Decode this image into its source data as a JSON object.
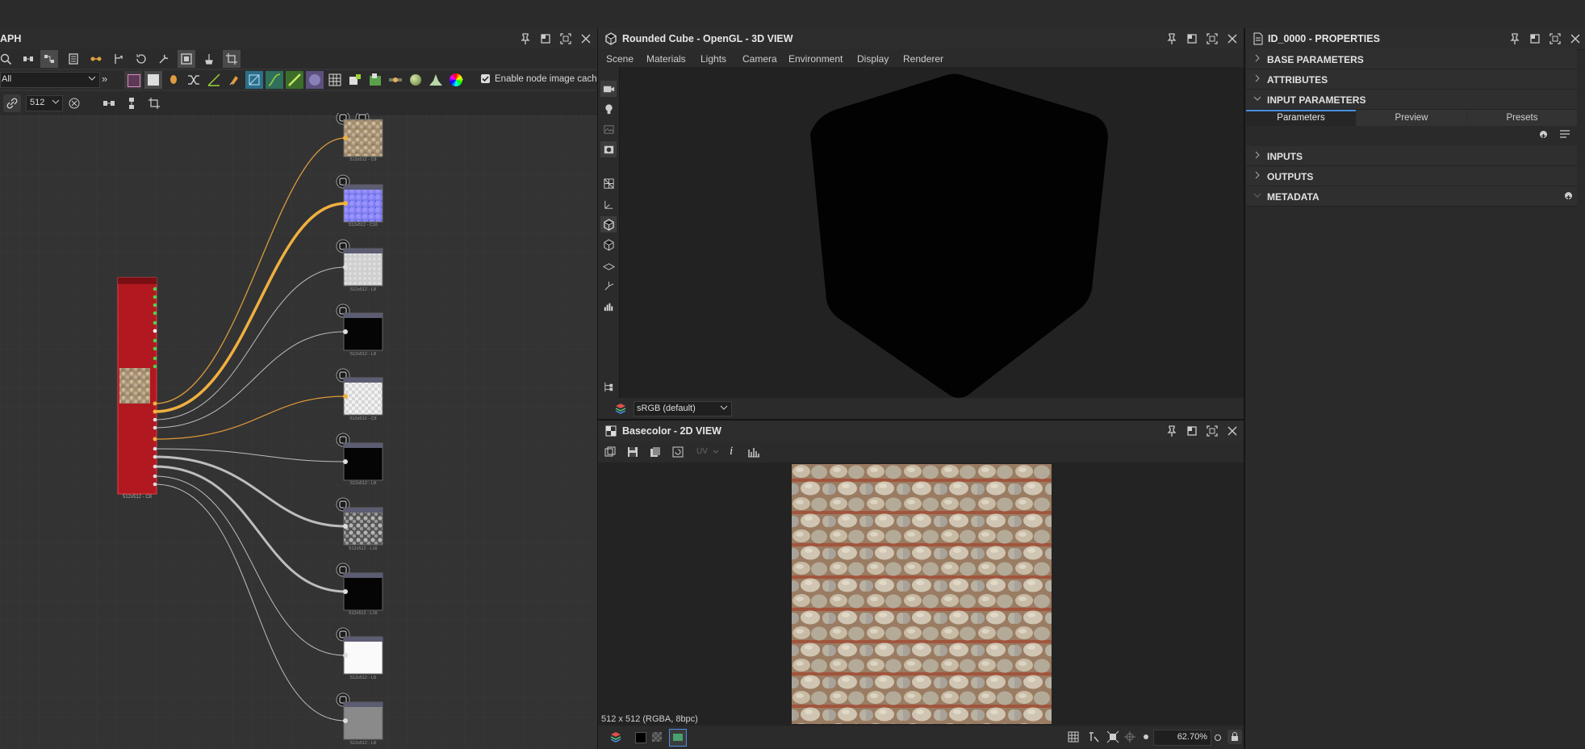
{
  "graph": {
    "title": "APH",
    "filter_value": "All",
    "enable_cache_label": "Enable node image cache",
    "resolution_value": "512",
    "more_label": "»",
    "output_node_label": "512x512 - C8",
    "nodes": [
      {
        "res": "512x512 - C8",
        "fill": "stone"
      },
      {
        "res": "512x512 - C16",
        "fill": "normal"
      },
      {
        "res": "512x512 - L8",
        "fill": "rough"
      },
      {
        "res": "512x512 - L8",
        "fill": "black"
      },
      {
        "res": "512x512 - C8",
        "fill": "checker"
      },
      {
        "res": "512x512 - L8",
        "fill": "black"
      },
      {
        "res": "512x512 - L16",
        "fill": "height"
      },
      {
        "res": "512x512 - L16",
        "fill": "black"
      },
      {
        "res": "512x512 - L8",
        "fill": "white"
      },
      {
        "res": "512x512 - L8",
        "fill": "gray"
      }
    ]
  },
  "view3d": {
    "title": "Rounded Cube - OpenGL - 3D VIEW",
    "menu": [
      "Scene",
      "Materials",
      "Lights",
      "Camera",
      "Environment",
      "Display",
      "Renderer"
    ],
    "colorspace": "sRGB (default)"
  },
  "view2d": {
    "title": "Basecolor - 2D VIEW",
    "uv_label": "UV",
    "info_label": "i",
    "status": "512 x 512 (RGBA, 8bpc)",
    "zoom": "62.70%"
  },
  "properties": {
    "title": "ID_0000 - PROPERTIES",
    "sections": [
      "BASE PARAMETERS",
      "ATTRIBUTES",
      "INPUT PARAMETERS"
    ],
    "tabs": [
      "Parameters",
      "Preview",
      "Presets"
    ],
    "subsections": [
      "INPUTS",
      "OUTPUTS",
      "METADATA"
    ]
  },
  "colors": {
    "accent": "#f0a830",
    "selected_tab_line": "#4a90e2",
    "output_node": "#b2181f"
  }
}
